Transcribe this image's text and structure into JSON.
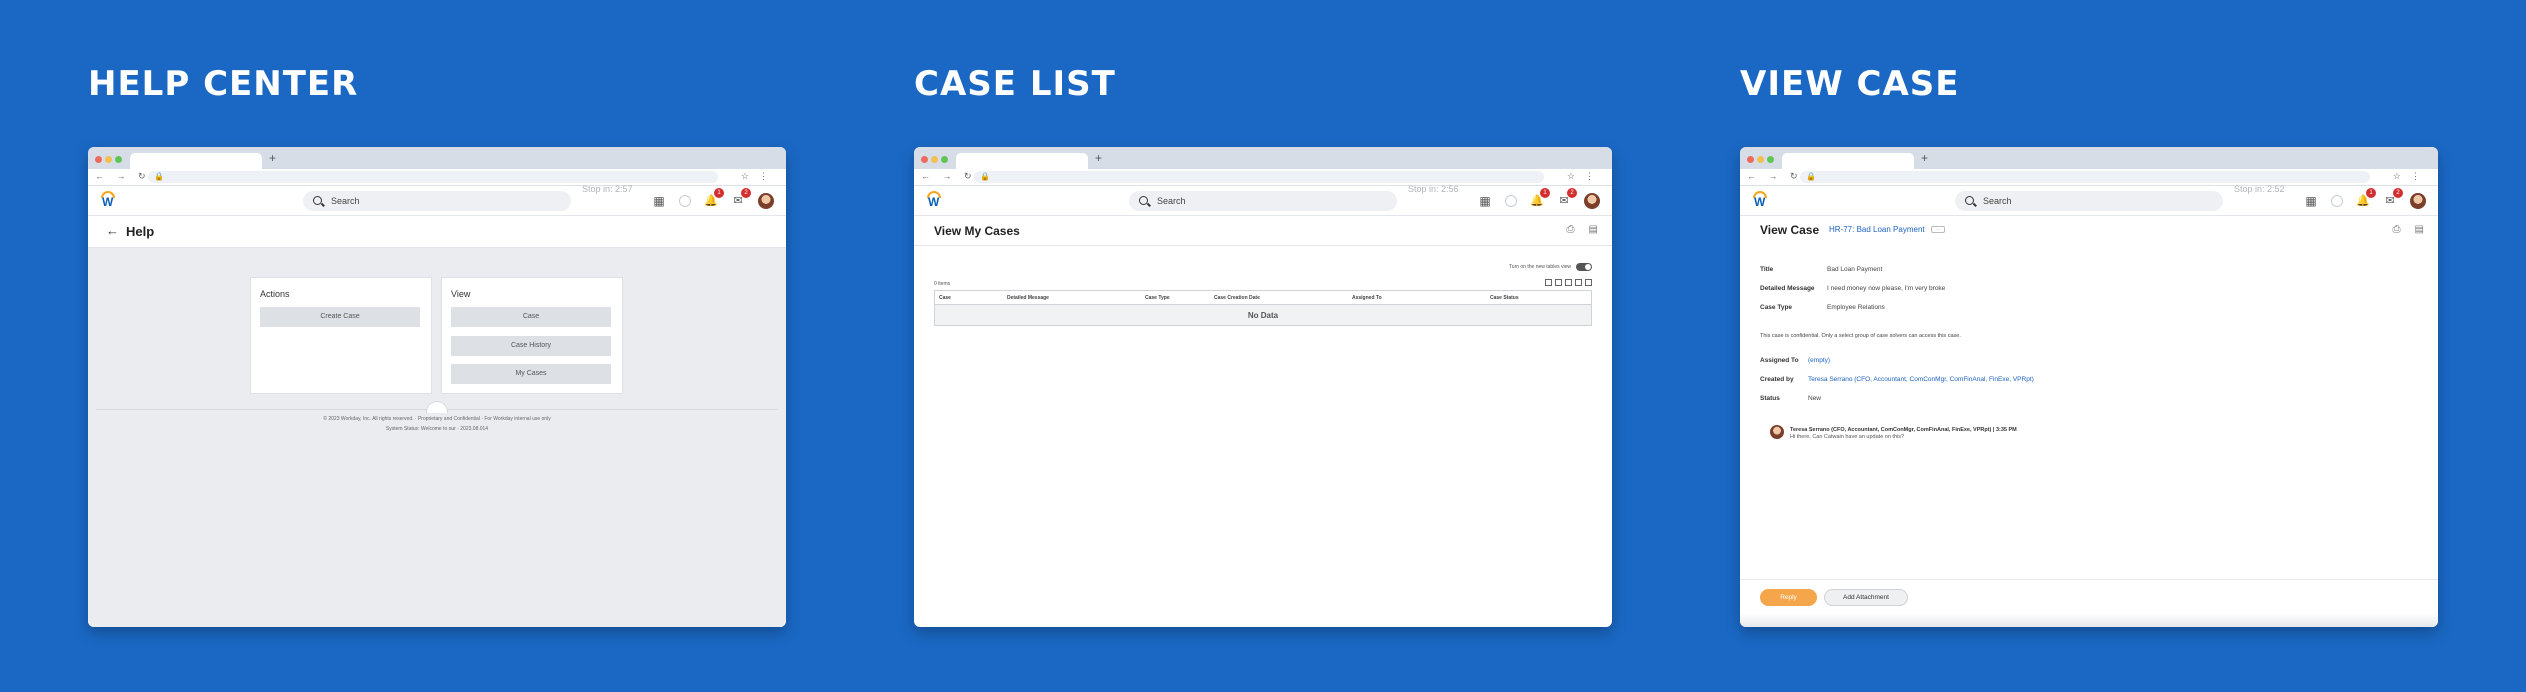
{
  "headings": [
    "HELP CENTER",
    "CASE LIST",
    "VIEW CASE"
  ],
  "browser": {
    "tab_plus": "+",
    "url": "",
    "search_placeholder": "Search",
    "help_stop": "Stop in: 2:57",
    "list_stop": "Stop in: 2:56",
    "view_stop": "Stop in: 2:52",
    "notif_badge": "1",
    "inbox_badge": "2"
  },
  "help": {
    "title": "Help",
    "actions_title": "Actions",
    "actions": [
      "Create Case"
    ],
    "view_title": "View",
    "view_items": [
      "Case",
      "Case History",
      "My Cases"
    ],
    "footer_copyright": "© 2023 Workday, Inc. All rights reserved. · Proprietary and Confidential · For Workday internal use only",
    "footer_status": "System Status: Welcome to our · 2023.08.014"
  },
  "list": {
    "title": "View My Cases",
    "toggle_label": "Turn on the new tables view",
    "items_count": "0 items",
    "columns": [
      "Case",
      "Detailed Message",
      "Case Type",
      "Case Creation Date",
      "Assigned To",
      "Case Status"
    ],
    "empty": "No Data"
  },
  "view": {
    "title": "View Case",
    "case_ref": "HR-77: Bad Loan Payment",
    "chip": "···",
    "fields": [
      {
        "label": "Title",
        "value": "Bad Loan Payment"
      },
      {
        "label": "Detailed Message",
        "value": "I need money now please, I'm very broke"
      },
      {
        "label": "Case Type",
        "value": "Employee Relations"
      }
    ],
    "confidential": "This case is confidential. Only a select group of case solvers can access this case.",
    "assigned_label": "Assigned To",
    "assigned_value": "(empty)",
    "created_label": "Created by",
    "created_value": "Teresa Serrano (CFO, Accountant, ComConMgr, ComFinAnal, FinExe, VPRpt)",
    "status_label": "Status",
    "status_value": "New",
    "message_author": "Teresa Serrano (CFO, Accountant, ComConMgr, ComFinAnal, FinExe, VPRpt) | 3:35 PM",
    "message_text": "Hi there, Can Catwain have an update on this?",
    "reply_label": "Reply",
    "attach_label": "Add Attachment"
  }
}
